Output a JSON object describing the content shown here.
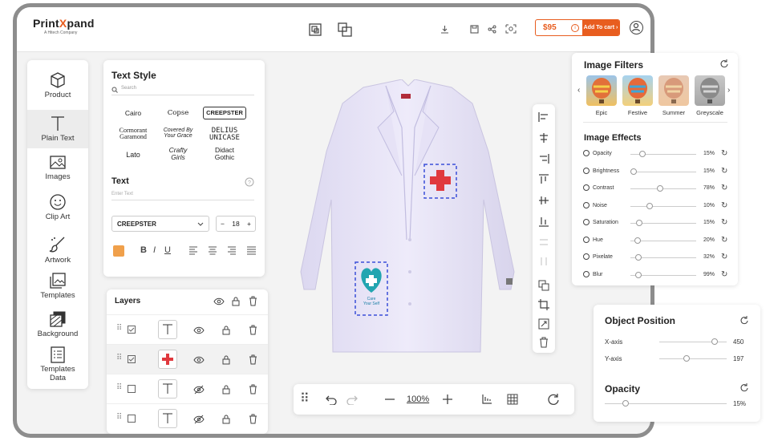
{
  "brand": {
    "name_prefix": "Print",
    "name_x": "X",
    "name_suffix": "pand",
    "tagline": "A Hitech Company"
  },
  "header": {
    "price": "$95",
    "add_to_cart": "Add To cart ›"
  },
  "sidebar": {
    "items": [
      {
        "label": "Product",
        "icon": "cube-icon"
      },
      {
        "label": "Plain Text",
        "icon": "text-icon"
      },
      {
        "label": "Images",
        "icon": "image-icon"
      },
      {
        "label": "Clip Art",
        "icon": "smiley-icon"
      },
      {
        "label": "Artwork",
        "icon": "brush-icon"
      },
      {
        "label": "Templates",
        "icon": "templates-icon"
      },
      {
        "label": "Background",
        "icon": "layers-icon"
      },
      {
        "label": "Templates",
        "label2": "Data",
        "icon": "list-icon"
      }
    ]
  },
  "text_style": {
    "title": "Text Style",
    "search_placeholder": "Search",
    "fonts": [
      "Cairo",
      "Copse",
      "CREEPSTER",
      "Cormorant Garamond",
      "Covered By Your Grace",
      "DELIUS UNICASE",
      "Lato",
      "Crafty Girls",
      "Didact Gothic"
    ],
    "font_lines": {
      "cormorant_1": "Cormorant",
      "cormorant_2": "Garamond",
      "covered_1": "Covered By",
      "covered_2": "Your Grace",
      "delius_1": "DELIUS",
      "delius_2": "UNICASE",
      "crafty_1": "Crafty",
      "crafty_2": "Girls",
      "didact_1": "Didact",
      "didact_2": "Gothic"
    },
    "text_label": "Text",
    "text_placeholder": "Enter Text",
    "selected_font": "CREEPSTER",
    "font_size": "18",
    "color": "#f0a04b"
  },
  "layers": {
    "title": "Layers",
    "rows": [
      {
        "checked": true,
        "type": "text",
        "visible": true
      },
      {
        "checked": true,
        "type": "cross",
        "visible": true
      },
      {
        "checked": false,
        "type": "text",
        "visible": false
      },
      {
        "checked": false,
        "type": "text",
        "visible": false
      }
    ]
  },
  "canvas": {
    "logo_line1": "Care",
    "logo_line2": "Your Self"
  },
  "bottom_bar": {
    "zoom": "100%"
  },
  "image_filters": {
    "title": "Image Filters",
    "filters": [
      {
        "label": "Epic"
      },
      {
        "label": "Festive"
      },
      {
        "label": "Summer"
      },
      {
        "label": "Greyscale"
      }
    ]
  },
  "image_effects": {
    "title": "Image Effects",
    "effects": [
      {
        "label": "Opacity",
        "value": "15%",
        "level": 0.15
      },
      {
        "label": "Brightness",
        "value": "15%",
        "level": 0.0
      },
      {
        "label": "Contrast",
        "value": "78%",
        "level": 0.45
      },
      {
        "label": "Noise",
        "value": "10%",
        "level": 0.27
      },
      {
        "label": "Saturation",
        "value": "15%",
        "level": 0.1
      },
      {
        "label": "Hue",
        "value": "20%",
        "level": 0.07
      },
      {
        "label": "Pixelate",
        "value": "32%",
        "level": 0.08
      },
      {
        "label": "Blur",
        "value": "99%",
        "level": 0.08
      }
    ]
  },
  "object_position": {
    "title": "Object Position",
    "x_label": "X-axis",
    "x_value": "450",
    "x_level": 0.85,
    "y_label": "Y-axis",
    "y_value": "197",
    "y_level": 0.4,
    "opacity_title": "Opacity",
    "opacity_value": "15%",
    "opacity_level": 0.15
  }
}
